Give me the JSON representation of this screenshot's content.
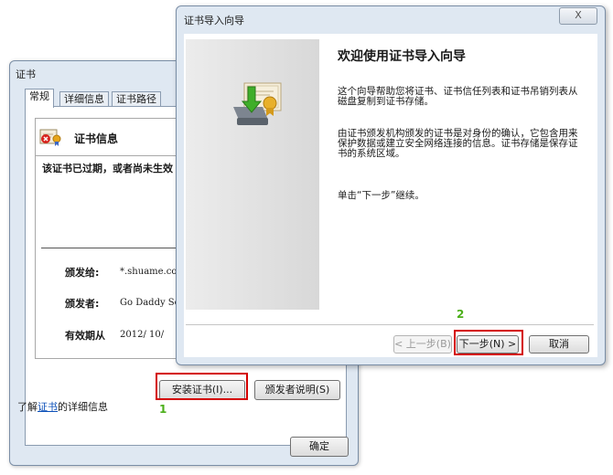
{
  "cert_dialog": {
    "title": "证书",
    "tabs": [
      "常规",
      "详细信息",
      "证书路径"
    ],
    "info_title": "证书信息",
    "status_text": "该证书已过期，或者尚未生效",
    "issued_to_label": "颁发给:",
    "issued_to_value": "*.shuame.com",
    "issued_by_label": "颁发者:",
    "issued_by_value": "Go Daddy Secure",
    "valid_from_label": "有效期从",
    "valid_from_value": "2012/ 10/",
    "install_button": "安装证书(I)...",
    "issuer_statement_button": "颁发者说明(S)",
    "learn_prefix": "了解",
    "learn_link": "证书",
    "learn_suffix": "的详细信息",
    "ok_button": "确定",
    "step_marker": "1"
  },
  "wizard": {
    "title": "证书导入向导",
    "close_label": "X",
    "heading": "欢迎使用证书导入向导",
    "paragraph1": "这个向导帮助您将证书、证书信任列表和证书吊销列表从磁盘复制到证书存储。",
    "paragraph2": "由证书颁发机构颁发的证书是对身份的确认，它包含用来保护数据或建立安全网络连接的信息。证书存储是保存证书的系统区域。",
    "paragraph3": "单击“下一步”继续。",
    "back_button": "< 上一步(B)",
    "next_button": "下一步(N) >",
    "cancel_button": "取消",
    "step_marker": "2"
  },
  "colors": {
    "highlight_box": "#d40000",
    "step_number": "#4caf1a",
    "link": "#0b4fb8"
  }
}
